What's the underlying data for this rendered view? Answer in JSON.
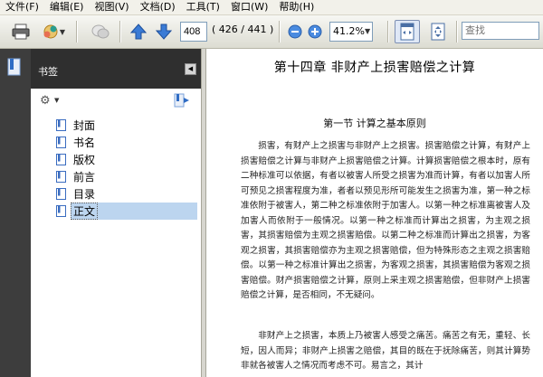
{
  "menu": [
    "文件(F)",
    "编辑(E)",
    "视图(V)",
    "文档(D)",
    "工具(T)",
    "窗口(W)",
    "帮助(H)"
  ],
  "toolbar": {
    "page_number": "408",
    "page_count": "( 426 / 441 )",
    "zoom": "41.2%",
    "search_placeholder": "查找"
  },
  "panel": {
    "title": "书签",
    "bookmarks": [
      {
        "label": "封面"
      },
      {
        "label": "书名"
      },
      {
        "label": "版权"
      },
      {
        "label": "前言"
      },
      {
        "label": "目录"
      },
      {
        "label": "正文",
        "selected": true
      }
    ]
  },
  "document": {
    "chapter": "第十四章   非财产上损害赔偿之计算",
    "section": "第一节   计算之基本原则",
    "para1": "损害，有财产上之损害与非财产上之损害。损害赔偿之计算，有财产上损害赔偿之计算与非财产上损害赔偿之计算。计算损害赔偿之根本时，原有二种标准可以依据，有者以被害人所受之损害为准而计算，有者以加害人所可预见之损害程度为准，者者以预见形所可能发生之损害为准，第一种之标准依附于被害人，第二种之标准依附于加害人。以第一种之标准离被害人及加害人而依附于一般情况。以第一种之标准而计算出之损害，为主观之损害，其损害赔偿为主观之损害赔偿。以第二种之标准而计算出之损害，为客观之损害，其损害赔偿亦为主观之损害赔偿，但为特殊形态之主观之损害赔偿。以第一种之标准计算出之损害，为客观之损害，其损害赔偿为客观之损害赔偿。财产损害赔偿之计算，原则上采主观之损害赔偿，但非财产上损害赔偿之计算，是否相同，不无疑问。",
    "para2": "非财产上之损害，本质上乃被害人感受之痛苦。痛苦之有无，重轻、长短，因人而异；非财产上损害之赔偿，其目的既在于抚除痛苦，则其计算势非就各被害人之情况而考虑不可。易言之，其计"
  }
}
